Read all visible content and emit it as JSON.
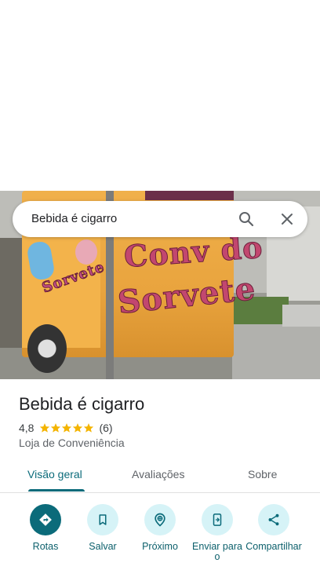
{
  "search": {
    "query": "Bebida é cigarro",
    "search_icon": "search-icon",
    "close_icon": "close-icon"
  },
  "photo": {
    "graffiti_1": "Conv do",
    "graffiti_2": "Sorvete",
    "graffiti_3": "Sorvete"
  },
  "place": {
    "name": "Bebida é cigarro",
    "rating": "4,8",
    "stars": 5,
    "review_count": "(6)",
    "category": "Loja de Conveniência",
    "star_color": "#f4b400"
  },
  "tabs": [
    {
      "label": "Visão geral",
      "active": true
    },
    {
      "label": "Avaliações",
      "active": false
    },
    {
      "label": "Sobre",
      "active": false
    }
  ],
  "actions": [
    {
      "label": "Rotas",
      "icon": "directions-icon"
    },
    {
      "label": "Salvar",
      "icon": "bookmark-icon"
    },
    {
      "label": "Próximo",
      "icon": "nearby-icon"
    },
    {
      "label": "Enviar para o",
      "icon": "send-to-phone-icon"
    },
    {
      "label": "Compartilhar",
      "icon": "share-icon"
    }
  ],
  "colors": {
    "accent": "#0b6b7a",
    "action_bg": "#d6f3f7"
  }
}
